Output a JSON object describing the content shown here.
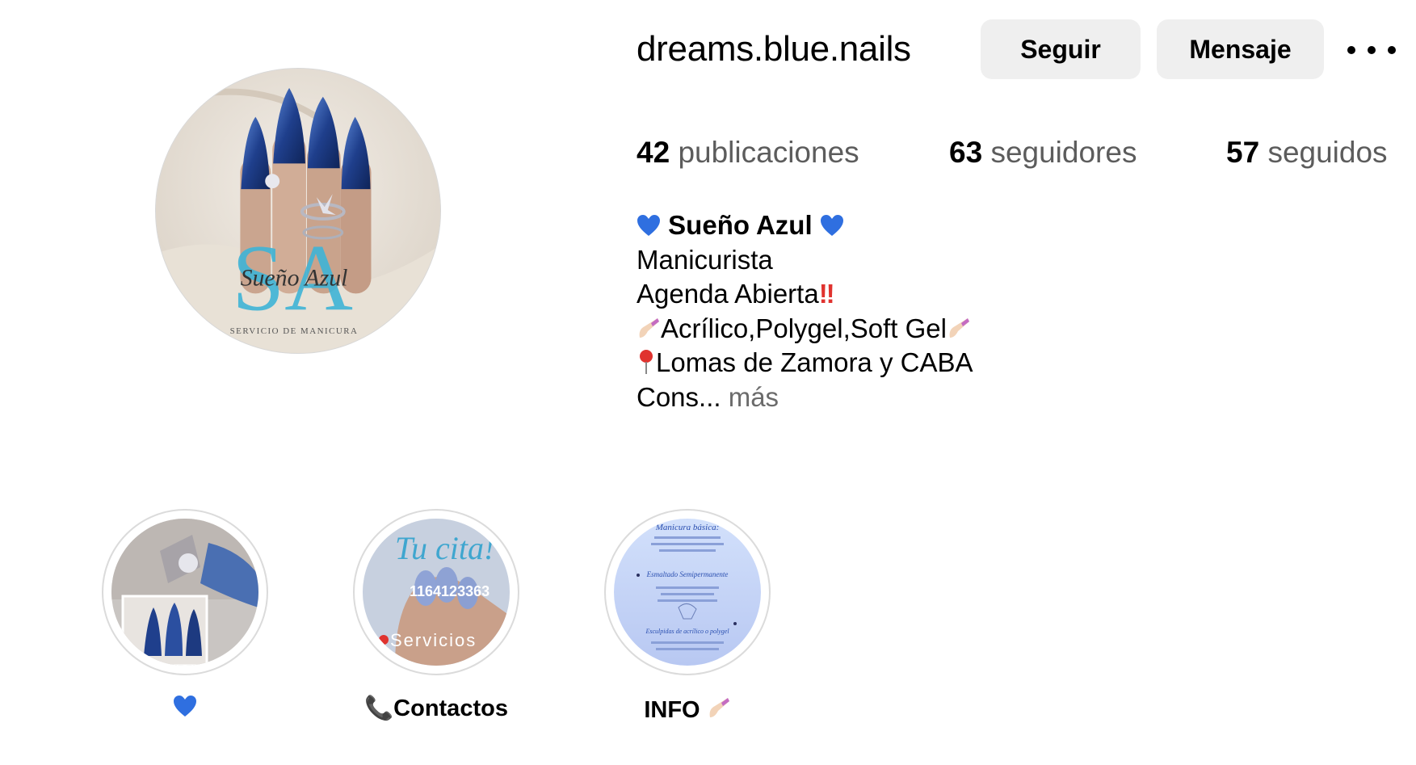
{
  "profile": {
    "username": "dreams.blue.nails",
    "avatar_icon": "profile-photo",
    "avatar_logo_text": "Sueño Azul",
    "avatar_logo_monogram": "SA",
    "avatar_logo_caption": "SERVICIO DE MANICURA"
  },
  "actions": {
    "follow_label": "Seguir",
    "message_label": "Mensaje",
    "more_icon": "more-options-icon"
  },
  "stats": {
    "posts_count": "42",
    "posts_label": "publicaciones",
    "followers_count": "63",
    "followers_label": "seguidores",
    "following_count": "57",
    "following_label": "seguidos"
  },
  "bio": {
    "name": "Sueño Azul",
    "line_role": "Manicurista",
    "line_agenda": "Agenda Abierta",
    "line_services": "Acrílico,Polygel,Soft Gel",
    "line_location": "Lomas de Zamora y CABA",
    "line_truncated": "Cons...",
    "more_label": "más"
  },
  "highlights": [
    {
      "label": "",
      "icon": "blue-heart-icon"
    },
    {
      "label": "Contactos",
      "icon": "telephone-icon",
      "overlay_title": "Tu cita!",
      "overlay_phone": "1164123363",
      "overlay_service": "Servicios"
    },
    {
      "label": "INFO",
      "icon": "nail-polish-icon",
      "overlay_title": "Manicura básica:",
      "overlay_sub1": "Esmaltado Semipermanente",
      "overlay_sub2": "Esculpidas de acrílico o polygel"
    }
  ],
  "colors": {
    "button_bg": "#efefef",
    "heart_blue": "#2f6fe0",
    "logo_teal": "#3fb4d6"
  }
}
